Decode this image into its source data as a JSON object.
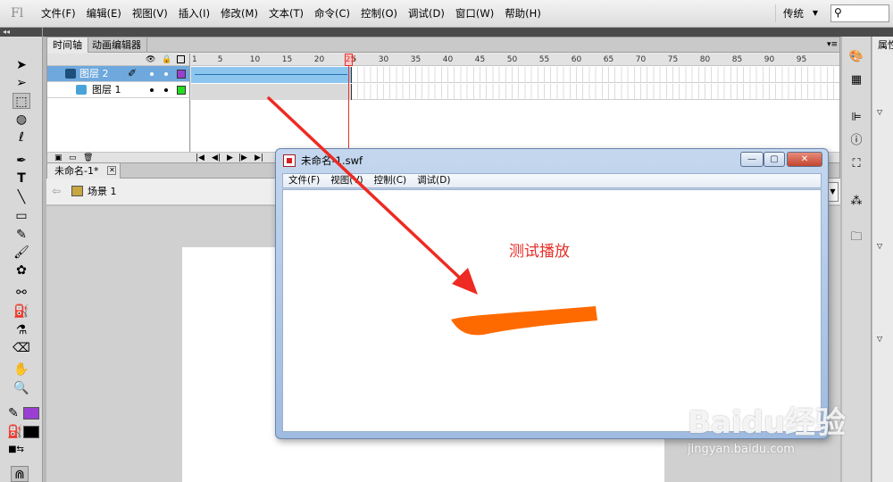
{
  "app": {
    "logo": "Fl"
  },
  "menu": [
    "文件(F)",
    "编辑(E)",
    "视图(V)",
    "插入(I)",
    "修改(M)",
    "文本(T)",
    "命令(C)",
    "控制(O)",
    "调试(D)",
    "窗口(W)",
    "帮助(H)"
  ],
  "workspace": {
    "label": "传统"
  },
  "search": {
    "placeholder": ""
  },
  "timeline": {
    "tabs": [
      "时间轴",
      "动画编辑器"
    ],
    "ruler": [
      "1",
      "5",
      "10",
      "15",
      "20",
      "25",
      "30",
      "35",
      "40",
      "45",
      "50",
      "55",
      "60",
      "65",
      "70",
      "75",
      "80",
      "85",
      "90",
      "95"
    ],
    "current_frame": "25",
    "layers": [
      {
        "name": "图层 2",
        "selected": true,
        "color": "#9a3fd1"
      },
      {
        "name": "图层 1",
        "selected": false,
        "color": "#22dd22"
      }
    ]
  },
  "document": {
    "tab_label": "未命名-1*",
    "close_glyph": "✕"
  },
  "scene": {
    "label": "场景 1"
  },
  "properties": {
    "tab_label": "属性"
  },
  "tool_colors": {
    "stroke": "#9a3fd1",
    "fill": "#000000"
  },
  "swf_window": {
    "title": "未命名-1.swf",
    "menu": [
      "文件(F)",
      "视图(V)",
      "控制(C)",
      "调试(D)"
    ],
    "controls": {
      "minimize": "—",
      "maximize": "▢",
      "close": "✕"
    },
    "stroke_color": "#ff6a00"
  },
  "annotation": {
    "text": "测试播放",
    "color": "#e52f2a"
  },
  "watermark": {
    "brand": "Baidu经验",
    "url": "jingyan.baidu.com"
  }
}
